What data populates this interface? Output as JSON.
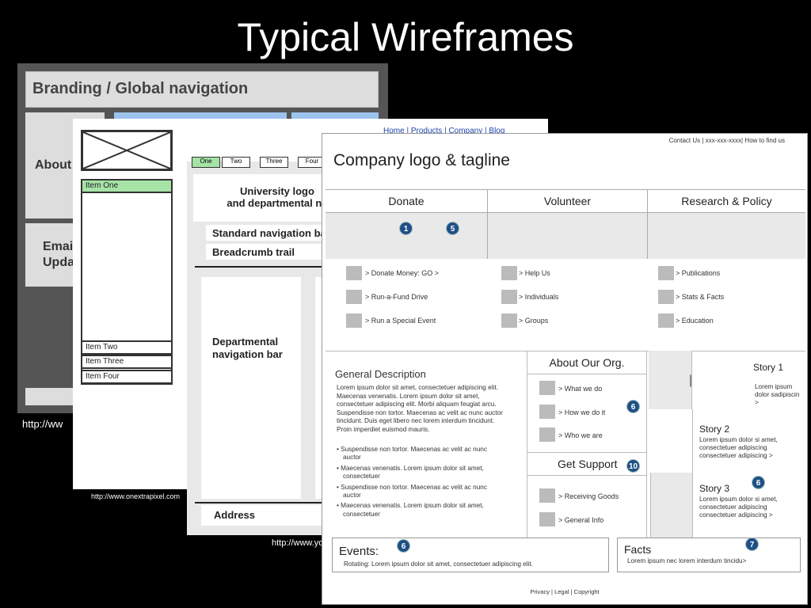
{
  "slide": {
    "title": "Typical Wireframes"
  },
  "wf1": {
    "header": "Branding / Global navigation",
    "about": "About",
    "email_line1": "Emai",
    "email_line2": "Upda",
    "url": "http://ww"
  },
  "wf2": {
    "topnav": "Home  |  Products  |  Company  |  Blog",
    "items": [
      "Item One",
      "Item Two",
      "Item Three",
      "Item Four"
    ],
    "url": "http://www.onextrapixel.com"
  },
  "wf3": {
    "tabs": [
      "One",
      "Two",
      "Three",
      "Four"
    ],
    "logo_line1": "University logo",
    "logo_line2": "and departmental na",
    "standard_nav": "Standard navigation ba",
    "breadcrumb": "Breadcrumb trail",
    "dept_line1": "Departmental",
    "dept_line2": "navigation bar",
    "address": "Address",
    "url": "http://www.yo"
  },
  "wf4": {
    "util_links": "Contact Us  |  xxx-xxx-xxxx|  How to find us",
    "brand": "Company logo & tagline",
    "nav": [
      "Donate",
      "Volunteer",
      "Research & Policy"
    ],
    "badges": {
      "b1": "1",
      "b5": "5",
      "b6a": "6",
      "b10": "10",
      "b6b": "6",
      "b6c": "6",
      "b7": "7"
    },
    "links_col1": [
      "> Donate Money:  GO >",
      "> Run-a-Fund  Drive",
      "> Run  a Special  Event"
    ],
    "links_col2": [
      "> Help Us",
      "> Individuals",
      "> Groups"
    ],
    "links_col3": [
      "> Publications",
      "> Stats & Facts",
      "> Education"
    ],
    "general_title": "General Description",
    "general_text": "Lorem ipsum dolor sit amet, consectetuer adipiscing elit. Maecenas venenatis. Lorem ipsum dolor sit amet, consectetuer adipiscing elit. Morbi aliquam feugiat arcu. Suspendisse non tortor. Maecenas ac velit ac nunc auctor tincidunt. Duis eget libero nec lorem interdum tincidunt. Proin imperdiet euismod mauris.",
    "bullets": [
      "• Suspendisse  non tortor.  Maecenas  ac velit ac nunc  auctor",
      "• Maecenas  venenatis.  Lorem ipsum  dolor sit amet,  consectetuer",
      "• Suspendisse  non tortor.  Maecenas  ac velit ac nunc  auctor",
      "• Maecenas  venenatis.  Lorem ipsum  dolor sit amet,  consectetuer"
    ],
    "about_title": "About Our Org.",
    "about_links": [
      "> What we do",
      "> How we do it",
      "> Who we are"
    ],
    "support_title": "Get Support",
    "support_links": [
      "> Receiving Goods",
      "> General Info"
    ],
    "story1_title": "Story 1",
    "story1_text": "Lorem ipsum dolor sadipiscin  >",
    "story2_title": "Story 2",
    "story2_text": "Lorem ipsum  dolor si amet, consectetuer  adipiscing consectetuer  adipiscing   >",
    "story3_title": "Story 3",
    "story3_text": "Lorem ipsum  dolor si amet, consectetuer  adipiscing consectetuer  adipiscing   >",
    "events_title": "Events:",
    "events_text": "Rotating: Lorem  ipsum  dolor  sit amet,  consectetuer  adipiscing  elit.",
    "facts_title": "Facts",
    "facts_text": "Lorem ipsum  nec lorem  interdum  tincidu>",
    "footer": "Privacy  |   Legal   |   Copyright"
  }
}
